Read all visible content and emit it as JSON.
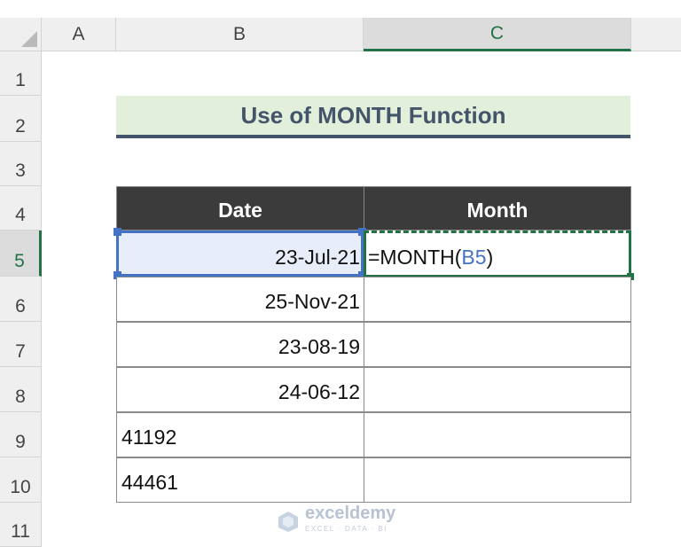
{
  "columns": [
    "A",
    "B",
    "C"
  ],
  "rows": [
    "1",
    "2",
    "3",
    "4",
    "5",
    "6",
    "7",
    "8",
    "9",
    "10",
    "11"
  ],
  "active_column": "C",
  "active_row": "5",
  "title": "Use of MONTH Function",
  "table": {
    "headers": [
      "Date",
      "Month"
    ],
    "rows": [
      {
        "date": "23-Jul-21",
        "month": ""
      },
      {
        "date": "25-Nov-21",
        "month": ""
      },
      {
        "date": "23-08-19",
        "month": ""
      },
      {
        "date": "24-06-12",
        "month": ""
      },
      {
        "date": "41192",
        "month": ""
      },
      {
        "date": "44461",
        "month": ""
      }
    ]
  },
  "formula": {
    "prefix": "=MONTH(",
    "ref": "B5",
    "suffix": ")"
  },
  "watermark": {
    "name": "exceldemy",
    "tagline": "EXCEL · DATA · BI"
  },
  "colors": {
    "accent_green": "#217346",
    "ref_blue": "#4472c4",
    "title_fill": "#e2efda",
    "header_fill": "#3b3b3b"
  },
  "icons": [
    "select-all-icon",
    "exceldemy-logo-icon"
  ]
}
